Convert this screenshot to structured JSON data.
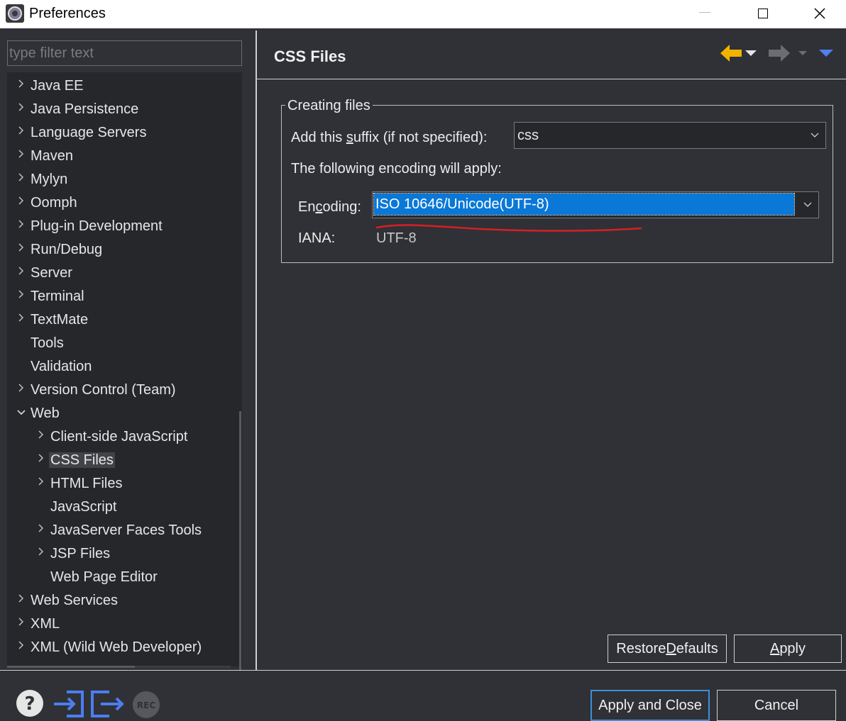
{
  "window": {
    "title": "Preferences"
  },
  "filter": {
    "placeholder": "type filter text"
  },
  "tree": {
    "items": [
      {
        "label": "Java EE",
        "level": 0,
        "expandable": true
      },
      {
        "label": "Java Persistence",
        "level": 0,
        "expandable": true
      },
      {
        "label": "Language Servers",
        "level": 0,
        "expandable": true
      },
      {
        "label": "Maven",
        "level": 0,
        "expandable": true
      },
      {
        "label": "Mylyn",
        "level": 0,
        "expandable": true
      },
      {
        "label": "Oomph",
        "level": 0,
        "expandable": true
      },
      {
        "label": "Plug-in Development",
        "level": 0,
        "expandable": true
      },
      {
        "label": "Run/Debug",
        "level": 0,
        "expandable": true
      },
      {
        "label": "Server",
        "level": 0,
        "expandable": true
      },
      {
        "label": "Terminal",
        "level": 0,
        "expandable": true
      },
      {
        "label": "TextMate",
        "level": 0,
        "expandable": true
      },
      {
        "label": "Tools",
        "level": 0,
        "expandable": false
      },
      {
        "label": "Validation",
        "level": 0,
        "expandable": false
      },
      {
        "label": "Version Control (Team)",
        "level": 0,
        "expandable": true
      },
      {
        "label": "Web",
        "level": 0,
        "expandable": true,
        "expanded": true
      },
      {
        "label": "Client-side JavaScript",
        "level": 1,
        "expandable": true
      },
      {
        "label": "CSS Files",
        "level": 1,
        "expandable": true,
        "selected": true
      },
      {
        "label": "HTML Files",
        "level": 1,
        "expandable": true
      },
      {
        "label": "JavaScript",
        "level": 1,
        "expandable": false
      },
      {
        "label": "JavaServer Faces Tools",
        "level": 1,
        "expandable": true
      },
      {
        "label": "JSP Files",
        "level": 1,
        "expandable": true
      },
      {
        "label": "Web Page Editor",
        "level": 1,
        "expandable": false
      },
      {
        "label": "Web Services",
        "level": 0,
        "expandable": true
      },
      {
        "label": "XML",
        "level": 0,
        "expandable": true
      },
      {
        "label": "XML (Wild Web Developer)",
        "level": 0,
        "expandable": true
      }
    ]
  },
  "page": {
    "title": "CSS Files",
    "group_title": "Creating files",
    "suffix_label_pre": "Add this ",
    "suffix_label_mnemonic": "s",
    "suffix_label_post": "uffix (if not specified):",
    "suffix_value": "css",
    "encoding_note": "The following encoding will apply:",
    "encoding_label_pre": "En",
    "encoding_label_mnemonic": "c",
    "encoding_label_post": "oding:",
    "encoding_value": "ISO 10646/Unicode(UTF-8)",
    "iana_label": "IANA:",
    "iana_value": "UTF-8",
    "restore_pre": "Restore ",
    "restore_mnemonic": "D",
    "restore_post": "efaults",
    "apply_mnemonic": "A",
    "apply_post": "pply"
  },
  "footer": {
    "apply_close_label": "Apply and Close",
    "cancel_label": "Cancel",
    "rec_label": "REC"
  },
  "colors": {
    "accent_selection": "#0a78d7",
    "back_arrow": "#f2b300",
    "annotation_underline": "#d81f26",
    "bottom_icons": "#4c7df0"
  }
}
